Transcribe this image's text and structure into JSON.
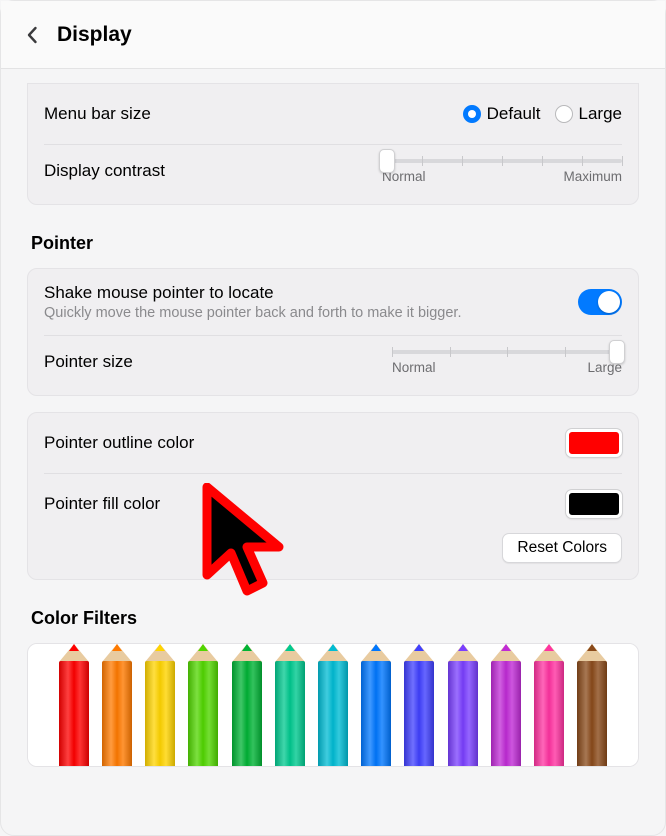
{
  "header": {
    "title": "Display"
  },
  "menuBar": {
    "label": "Menu bar size",
    "options": {
      "default": "Default",
      "large": "Large"
    },
    "selected": "default"
  },
  "contrast": {
    "label": "Display contrast",
    "min_label": "Normal",
    "max_label": "Maximum",
    "value_pct": 2
  },
  "pointer": {
    "heading": "Pointer",
    "shake": {
      "title": "Shake mouse pointer to locate",
      "subtitle": "Quickly move the mouse pointer back and forth to make it bigger.",
      "on": true
    },
    "size": {
      "label": "Pointer size",
      "min_label": "Normal",
      "max_label": "Large",
      "value_pct": 98
    },
    "outline": {
      "label": "Pointer outline color",
      "color": "#ff0000"
    },
    "fill": {
      "label": "Pointer fill color",
      "color": "#000000"
    },
    "reset_label": "Reset Colors"
  },
  "filters": {
    "heading": "Color Filters",
    "pencil_colors": [
      "#ff0000",
      "#ff7a00",
      "#ffd400",
      "#51d600",
      "#00b335",
      "#00c98f",
      "#00bcd4",
      "#0077ff",
      "#4040ff",
      "#7a3fff",
      "#c02bd6",
      "#ff33a1",
      "#8a4a1a"
    ]
  }
}
